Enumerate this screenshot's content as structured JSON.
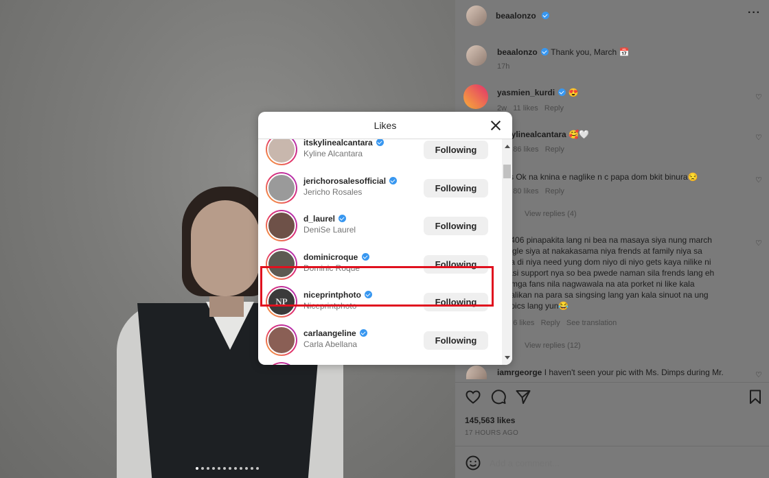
{
  "post_author": {
    "username": "beaalonzo",
    "more_icon": "more-horizontal-icon"
  },
  "caption": {
    "username": "beaalonzo",
    "text": "Thank you, March 📅",
    "time": "17h"
  },
  "comments": [
    {
      "username": "yasmien_kurdi",
      "text": "😍",
      "meta": "2w   11 likes   Reply"
    },
    {
      "username": "itskylinealcantara",
      "text": "🥰🤍",
      "meta": "2w   86 likes   Reply"
    },
    {
      "text": "jjavs Ok na knina e naglike n c papa dom bkit binura😒",
      "meta": "2w   80 likes   Reply",
      "view_replies": "View replies (4)"
    },
    {
      "text": "ke2406 pinapakita lang ni bea na masaya siya nung march\nt single siya at nakakasama niya frends at family niya sa\nal na di niya need yung dom niyo di niyo gets kaya nilike ni\nn kasi support nya so bea pwede naman sila frends lang eh\nt to mga fans nila nagwawala na ata porket ni like kala\nkabalikan na para sa singsing lang yan kala sinuot na ung\nold pics lang yun😂",
      "meta": "2w   6 likes   Reply   See translation",
      "view_replies": "View replies (12)"
    },
    {
      "username": "iamrgeorge",
      "text": "I haven't seen your pic with Ms. Dimps during Mr."
    }
  ],
  "actions": {
    "like_icon": "heart-icon",
    "comment_icon": "comment-icon",
    "share_icon": "send-icon",
    "save_icon": "bookmark-icon"
  },
  "likes_count": "145,563 likes",
  "posted_time": "17 hours ago",
  "add_comment": {
    "emoji_icon": "smiley-icon",
    "placeholder": "Add a comment..."
  },
  "likes_modal": {
    "title": "Likes",
    "close_icon": "close-icon",
    "users": [
      {
        "username": "itskylinealcantara",
        "full_name": "Kyline Alcantara",
        "button": "Following",
        "avatar_color": "#c8b7ad"
      },
      {
        "username": "jerichorosalesofficial",
        "full_name": "Jericho Rosales",
        "button": "Following",
        "avatar_color": "#9a9a9a"
      },
      {
        "username": "d_laurel",
        "full_name": "DeniSe Laurel",
        "button": "Following",
        "avatar_color": "#6e5148"
      },
      {
        "username": "dominicroque",
        "full_name": "Dominic Roque",
        "button": "Following",
        "avatar_color": "#5d5a52"
      },
      {
        "username": "niceprintphoto",
        "full_name": "Niceprintphoto",
        "button": "Following",
        "avatar_color": "#3a3a3a",
        "avatar_text": "NP"
      },
      {
        "username": "carlaangeline",
        "full_name": "Carla Abellana",
        "button": "Following",
        "avatar_color": "#8a5f55"
      }
    ],
    "highlight_color": "#e0101e"
  }
}
